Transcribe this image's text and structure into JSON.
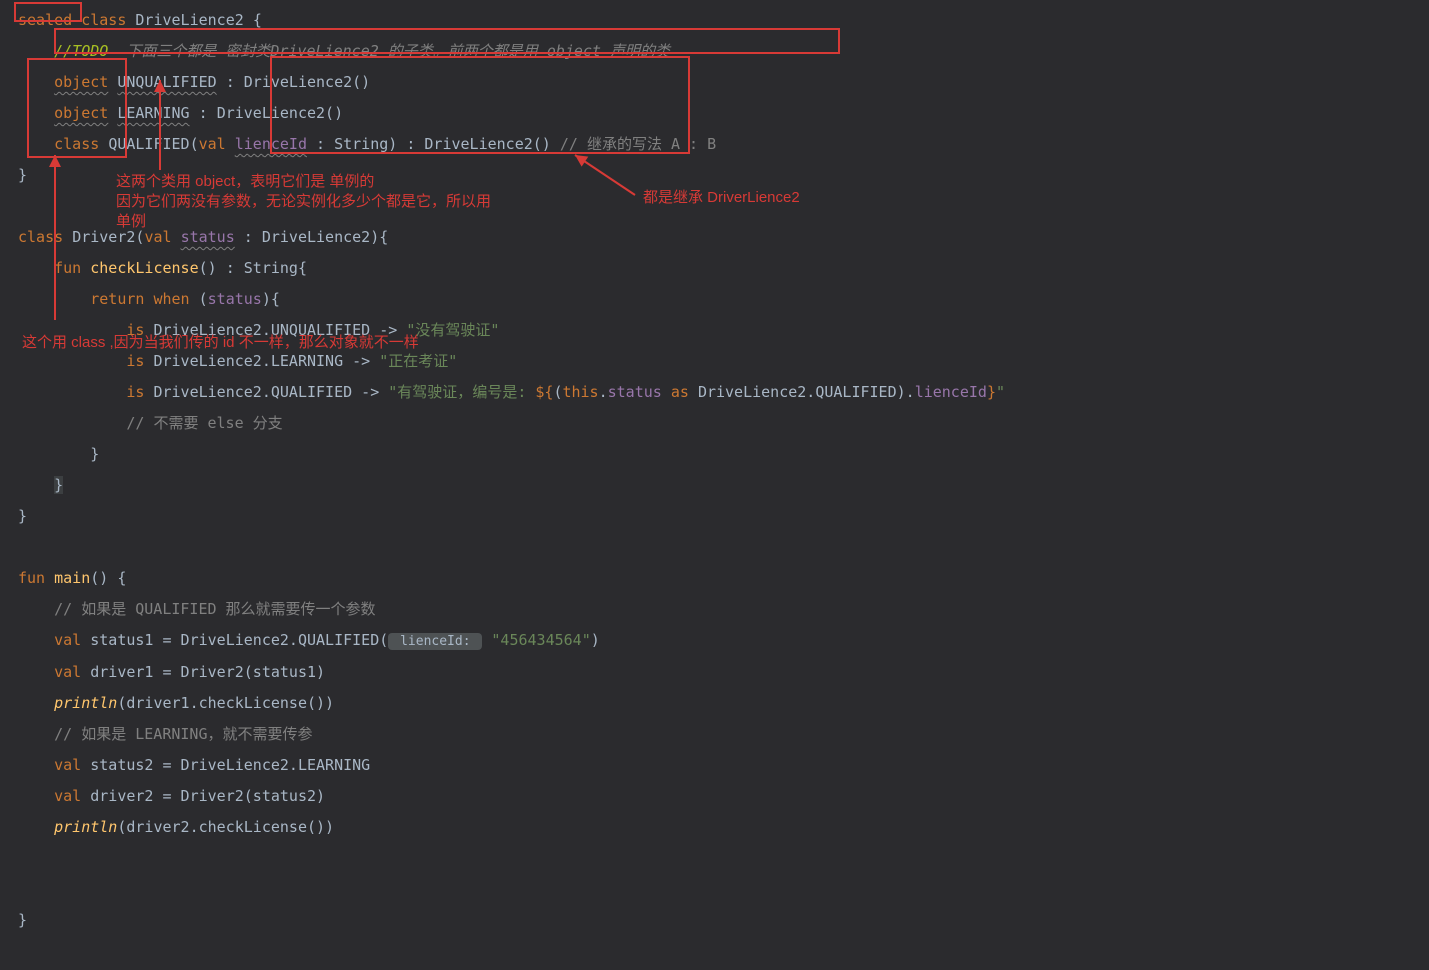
{
  "code": {
    "l1": {
      "sealed": "sealed",
      "class": "class",
      "name": "DriveLience2",
      "brace": "{"
    },
    "l2": {
      "todo_tag": "//TODO",
      "todo_text": "  下面三个都是 密封类DriveLience2 的子类。前两个都是用 object 声明的类"
    },
    "l3": {
      "obj": "object",
      "name": "UNQUALIFIED",
      "colon": ":",
      "parent": "DriveLience2()"
    },
    "l4": {
      "obj": "object",
      "name": "LEARNING",
      "colon": ":",
      "parent": "DriveLience2()"
    },
    "l5": {
      "cls": "class",
      "name": "QUALIFIED(",
      "val": "val",
      "prop": "lienceId",
      "type": " : String) : DriveLience2()",
      "cmt": " // 继承的写法 A : B"
    },
    "l6": {
      "brace": "}"
    },
    "l7": {
      "cls": "class",
      "name": "Driver2(",
      "val": "val",
      "prop": "status",
      "type": " : DriveLience2){"
    },
    "l8": {
      "fun": "fun",
      "fname": "checkLicense",
      "sig": "() : String{"
    },
    "l9": {
      "ret": "return",
      "when": "when",
      "open": " (",
      "status": "status",
      "close": "){"
    },
    "l10": {
      "is": "is",
      "expr": " DriveLience2.UNQUALIFIED -> ",
      "str": "\"没有驾驶证\""
    },
    "l11": {
      "is": "is",
      "expr": " DriveLience2.LEARNING -> ",
      "str": "\"正在考证\""
    },
    "l12": {
      "is": "is",
      "expr": " DriveLience2.QUALIFIED -> ",
      "str1": "\"有驾驶证，编号是: ",
      "d1": "${",
      "p1": "(",
      "this": "this",
      "dot": ".",
      "status": "status",
      "as": " as ",
      "cast": "DriveLience2.QUALIFIED).",
      "prop": "lienceId",
      "d2": "}",
      "str2": "\""
    },
    "l13": {
      "cmt": "// 不需要 else 分支"
    },
    "l14": {
      "brace": "}"
    },
    "l15": {
      "brace": "}"
    },
    "l16": {
      "brace": "}"
    },
    "l18": {
      "fun": "fun",
      "fname": "main",
      "sig": "() {"
    },
    "l19": {
      "cmt": "// 如果是 QUALIFIED 那么就需要传一个参数"
    },
    "l20": {
      "val": "val",
      "v": "status1 = DriveLience2.QUALIFIED(",
      "hint": " lienceId: ",
      "str": "\"456434564\"",
      "close": ")"
    },
    "l21": {
      "val": "val",
      "v": "driver1 = Driver2(status1)"
    },
    "l22": {
      "fn": "println",
      "args": "(driver1.checkLicense())"
    },
    "l23": {
      "cmt": "// 如果是 LEARNING，就不需要传参"
    },
    "l24": {
      "val": "val",
      "v": "status2 = DriveLience2.LEARNING"
    },
    "l25": {
      "val": "val",
      "v": "driver2 = Driver2(status2)"
    },
    "l26": {
      "fn": "println",
      "args": "(driver2.checkLicense())"
    },
    "l28": {
      "brace": "}"
    }
  },
  "annotations": {
    "a1_l1": "这两个类用 object，表明它们是 单例的",
    "a1_l2": "因为它们两没有参数，无论实例化多少个都是它，所以用",
    "a1_l3": "单例",
    "a2": "都是继承 DriverLience2",
    "a3": "这个用 class ,因为当我们传的 id 不一样，那么对象就不一样"
  }
}
